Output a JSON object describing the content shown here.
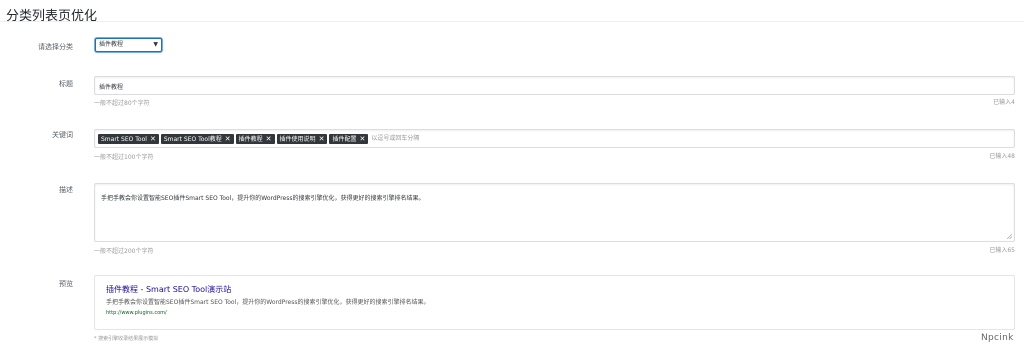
{
  "page": {
    "title": "分类列表页优化"
  },
  "category": {
    "label": "请选择分类",
    "selected": "插件教程"
  },
  "title_field": {
    "label": "标题",
    "value": "插件教程",
    "hint": "一般不超过80个字符",
    "count": "已输入4"
  },
  "keywords": {
    "label": "关键词",
    "tags": [
      "Smart SEO Tool",
      "Smart SEO Tool教程",
      "插件教程",
      "插件使用说明",
      "插件配置"
    ],
    "remove_symbol": "✕",
    "placeholder": "以逗号或回车分隔",
    "hint": "一般不超过100个字符",
    "count": "已输入48"
  },
  "description": {
    "label": "描述",
    "value": "手把手教会你设置智能SEO插件Smart SEO Tool，提升你的WordPress的搜索引擎优化，获得更好的搜索引擎排名结果。",
    "hint": "一般不超过200个字符",
    "count": "已输入65"
  },
  "preview": {
    "label": "预览",
    "title": "插件教程 - Smart SEO Tool演示站",
    "desc": "手把手教会你设置智能SEO插件Smart SEO Tool，提升你的WordPress的搜索引擎优化，获得更好的搜索引擎排名结果。",
    "url": "http://www.plugins.com/",
    "note": "* 搜索引擎收录结果展示模拟"
  },
  "watermark": "Npcink"
}
